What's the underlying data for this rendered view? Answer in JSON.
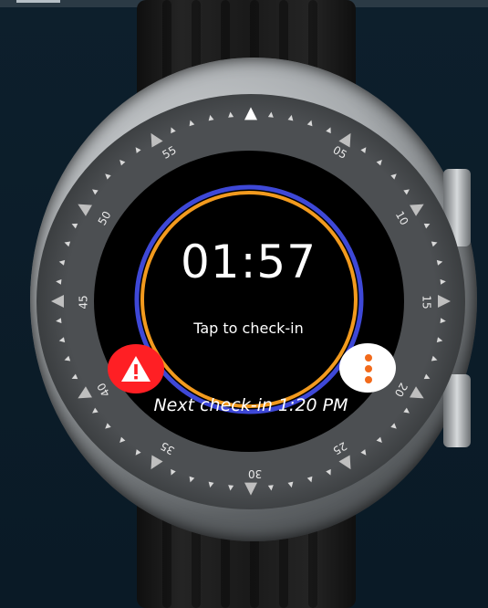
{
  "watch": {
    "timer": "01:57",
    "tap_label": "Tap to check-in",
    "next_checkin": "Next check-in 1:20 PM"
  },
  "bezel": {
    "numbers": [
      "55",
      "05",
      "10",
      "15",
      "20",
      "25",
      "30",
      "35",
      "40",
      "45",
      "50"
    ]
  },
  "icons": {
    "sos": "warning-triangle-icon",
    "menu": "more-vertical-icon"
  },
  "colors": {
    "ring_outer": "#3e48d7",
    "ring_inner": "#f29a1e",
    "sos": "#ff1f24",
    "menu_dots": "#f26a1b"
  }
}
